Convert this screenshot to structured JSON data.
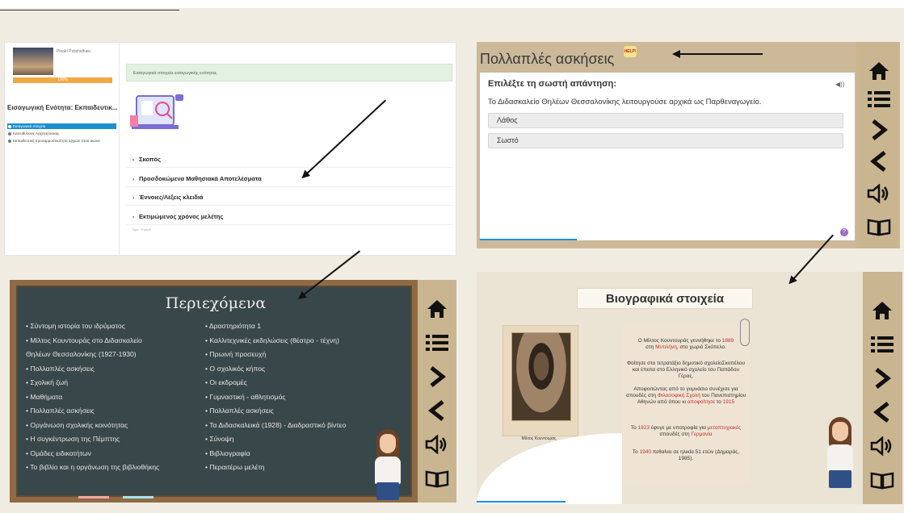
{
  "lms": {
    "user_name": "Pinakí Polishidhaki",
    "progress_label": "100%",
    "unit_title": "Εισαγωγική Ενότητα: Εκπαιδευτικ...",
    "side_items": [
      "Εισαγωγικά στοιχεία",
      "Κατευθυνσεις Αρχιτεκτονικής",
      "Εκπαιδευτική προσαρμοστικότητα αρχιών 21ου αιώνα"
    ],
    "banner": "Εισαγωγικά στοιχεία εισαγωγικής ενότητας",
    "accordion": [
      "Σκοπός",
      "Προσδοκώμενα Μαθησιακά Αποτελέσματα",
      "Έννοιες/Λέξεις κλειδιά",
      "Εκτιμώμενος χρόνος μελέτης"
    ],
    "footer": "Ώρα · Καθοδ"
  },
  "quiz": {
    "title": "Πολλαπλές ασκήσεις",
    "help_badge": "HELP!",
    "question": "Επιλέξτε τη σωστή απάντηση:",
    "statement": "Το Διδασκαλείο Θηλέων Θεσσαλονίκης λειτουργούσε αρχικά ως Παρθεναγωγείο.",
    "options": [
      "Λάθος",
      "Σωστό"
    ]
  },
  "contents": {
    "title": "Περιεχόμενα",
    "left": [
      "• Σύντομη ιστορία του ιδρύματος",
      "• Μίλτος Κουντουράς στο Διδασκαλείο",
      "  Θηλέων Θεσσαλονίκης (1927-1930)",
      "• Πολλαπλές ασκήσεις",
      "• Σχολική ζωή",
      "• Μαθήματα",
      "• Πολλαπλές ασκήσεις",
      "• Οργάνωση σχολικής κοινότητας",
      "• Η συγκέντρωση της Πέμπτης",
      "• Ομάδες ειδικοτήτων",
      "• Το βιβλίο και η οργάνωση της βιβλιοθήκης"
    ],
    "right": [
      "• Δραστηριότητα 1",
      "• Καλλιτεχνικές εκδηλώσεις (θέατρο - τέχνη)",
      "• Πρωινή προσευχή",
      "• Ο σχολικός κήπος",
      "• Οι εκδρομές",
      "• Γυμναστική - αθλητισμός",
      "• Πολλαπλές ασκήσεις",
      "• Τα Διδασκαλεικά (1928) - Διαδραστικό βίντεο",
      "• Σύνοψη",
      "• Βιβλιογραφία",
      "• Περαιτέρω μελέτη"
    ]
  },
  "bio": {
    "title": "Βιογραφικά στοιχεία",
    "caption": "Μίλτος Κουντουράς",
    "p1a": "Ο Μίλτος Κουντουράς γεννήθηκε το ",
    "p1b": "1889",
    "p1c": "στη ",
    "p1d": "Μυτιλήνη",
    "p1e": ", στο χωριό Σκόπελο.",
    "p2": "Φοίτησε στο τετρατάξιο δημοτικό σχολείοΣκοπέλου και έπειτα στο Ελληνικό σχολείο του Παπάδου Γέρας.",
    "p3a": "Αποφοιτώντας από το γυμνάσιο συνέχισε για σπουδές στη ",
    "p3b": "Φιλοσοφική Σχολή",
    "p3c": " του Πανεπιστημίου Αθηνών από όπου κι ",
    "p3d": "αποφοίτησε",
    "p3e": " το ",
    "p3f": "1915",
    "p4a": "Το ",
    "p4b": "1923",
    "p4c": " έφυγε με υποτροφία για ",
    "p4d": "μεταπτυχιακές",
    "p4e": " σπουδές στη ",
    "p4f": "Γερμανία",
    "p5a": "Το ",
    "p5b": "1940",
    "p5c": " πεθαίνει σε ηλικία 51 ετών (Δημαράς, 1985)."
  },
  "nav_icons": [
    "home-icon",
    "menu-icon",
    "next-icon",
    "back-icon",
    "speaker-icon",
    "book-icon"
  ],
  "colors": {
    "board": "#38474a",
    "wood": "#c9b590",
    "accent_blue": "#1f8fd8",
    "highlight_red": "#c0302a"
  }
}
